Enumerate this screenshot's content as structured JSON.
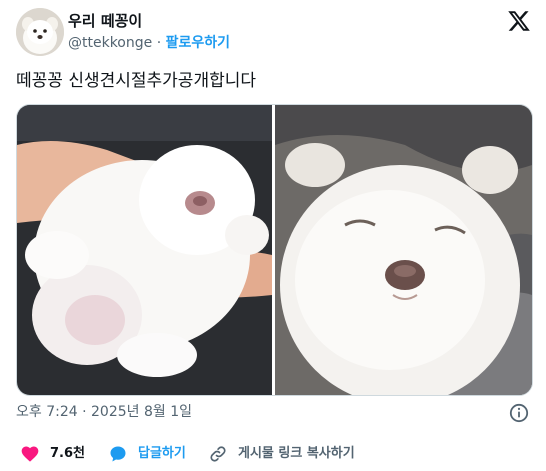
{
  "author": {
    "display_name": "우리 떼꽁이",
    "handle": "@ttekkonge",
    "separator": "·",
    "follow_label": "팔로우하기",
    "avatar_icon": "puppy-avatar"
  },
  "brand": {
    "logo_icon": "x-logo-icon"
  },
  "tweet": {
    "text": "떼꽁꽁 신생견시절추가공개합니다",
    "timestamp": "오후 7:24 · 2025년 8월 1일"
  },
  "media": [
    {
      "icon": "puppy-held-in-hand-photo"
    },
    {
      "icon": "puppy-sleeping-closeup-photo"
    }
  ],
  "actions": {
    "like": {
      "count": "7.6천",
      "icon": "heart-icon",
      "color": "#f91880"
    },
    "reply": {
      "label": "답글하기",
      "icon": "reply-bubble-icon",
      "color": "#1d9bf0"
    },
    "copy_link": {
      "label": "게시물 링크 복사하기",
      "icon": "link-icon"
    }
  },
  "colors": {
    "accent": "#1d9bf0",
    "text": "#0f1419",
    "secondary": "#536471",
    "like": "#f91880"
  }
}
